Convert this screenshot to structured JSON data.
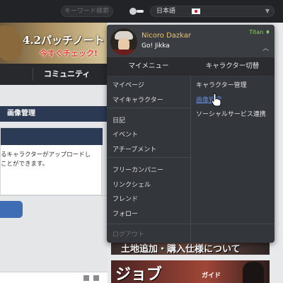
{
  "topbar": {
    "search_placeholder": "キーワード検索",
    "language": "日本語"
  },
  "banner": {
    "title": "4.2パッチノート",
    "subtitle": "今すぐチェック!"
  },
  "nav": {
    "community": "コミュニティ"
  },
  "content": {
    "section_title": "画像管理",
    "text_line1": "るキャラクターがアップロードし",
    "text_line2": "ことができます。"
  },
  "profile": {
    "name": "Nicoro Dazkar",
    "world": "Go! Jikka",
    "server": "Titan",
    "server_icon": "crystal-icon"
  },
  "menu": {
    "my_menu_header": "マイメニュー",
    "character_switch_header": "キャラクター切替",
    "left_items": [
      "マイページ",
      "マイキャラクター",
      "日記",
      "イベント",
      "アチーブメント",
      "フリーカンパニー",
      "リンクシェル",
      "フレンド",
      "フォロー",
      "ログアウト"
    ],
    "right_items": [
      "キャラクター管理",
      "画像管理",
      "ソーシャルサービス連携"
    ]
  },
  "promos": {
    "land_text": "土地追加・購入仕様について",
    "job_text": "ジョブ",
    "job_sub": "ガイド"
  }
}
